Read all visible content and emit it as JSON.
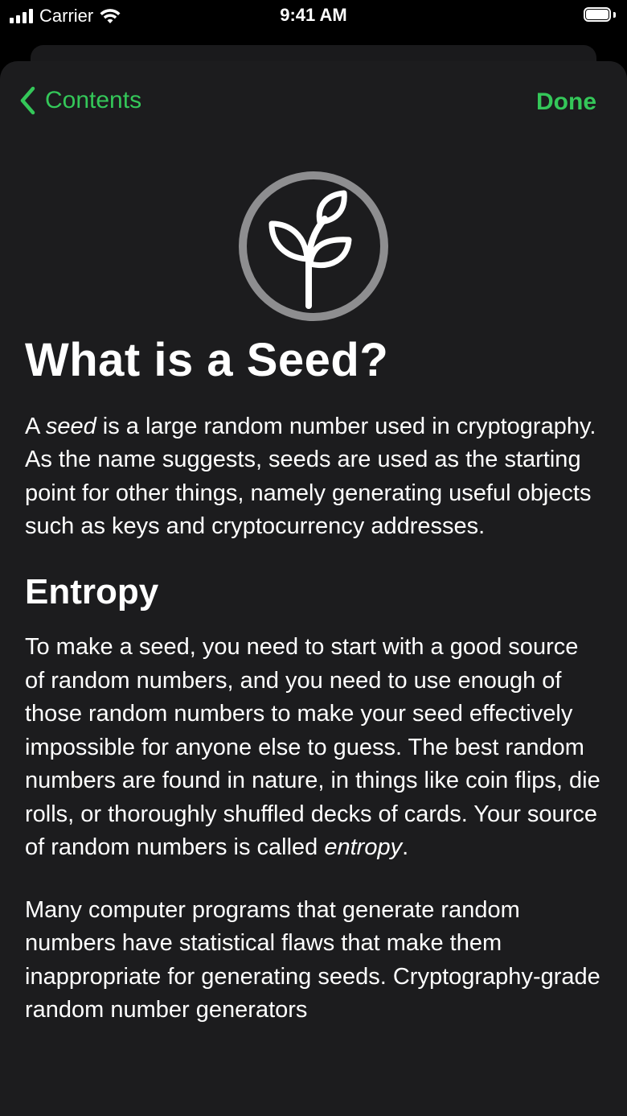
{
  "status_bar": {
    "carrier": "Carrier",
    "time": "9:41 AM"
  },
  "nav": {
    "back_label": "Contents",
    "done_label": "Done",
    "accent_color": "#34c759"
  },
  "hero": {
    "icon": "seedling-icon"
  },
  "article": {
    "title": "What is a Seed?",
    "p1": {
      "a": "A ",
      "b": "seed",
      "c": " is a large random number used in cryptography. As the name suggests, seeds are used as the starting point for other things, namely generating useful objects such as keys and cryptocurrency addresses."
    },
    "heading_entropy": "Entropy",
    "p2": {
      "a": "To make a seed, you need to start with a good source of random numbers, and you need to use enough of those random numbers to make your seed effectively impossible for anyone else to guess. The best random numbers are found in nature, in things like coin flips, die rolls, or thoroughly shuffled decks of cards. Your source of random numbers is called ",
      "b": "entropy",
      "c": "."
    },
    "p3": "Many computer programs that generate random numbers have statistical flaws that make them inappropriate for generating seeds. Cryptography-grade random number generators"
  }
}
